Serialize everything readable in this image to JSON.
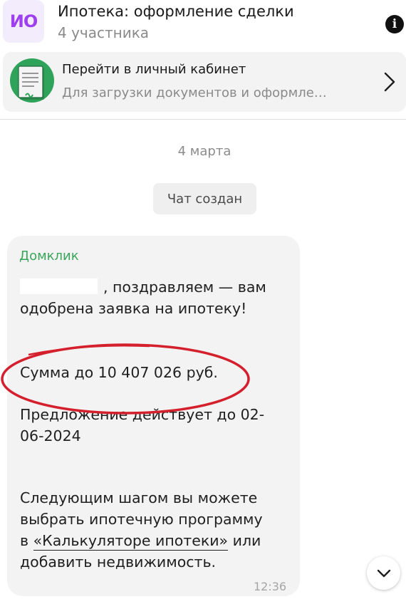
{
  "header": {
    "avatar_initials": "ИО",
    "title": "Ипотека: оформление сделки",
    "subtitle": "4 участника",
    "info_icon": "info-icon"
  },
  "banner": {
    "title": "Перейти в личный кабинет",
    "subtitle": "Для загрузки документов и оформле…",
    "icon": "document-icon",
    "chevron": "chevron-right-icon"
  },
  "chat": {
    "date": "4 марта",
    "system_message": "Чат создан"
  },
  "message": {
    "sender": "Домклик",
    "line1": ", поздравляем — вам",
    "line2": "одобрена заявка на ипотеку!",
    "sum": "Сумма до 10 407 026 руб.",
    "offer_line1": "Предложение действует до 02-",
    "offer_line2": "06-2024",
    "next_line1": "Следующим шагом вы можете",
    "next_line2": "выбрать ипотечную программу",
    "next_line3_prefix": "в ",
    "link_text": "«Калькуляторе ипотеки»",
    "next_line3_suffix": " или",
    "next_line4": "добавить недвижимость.",
    "time": "12:36"
  },
  "colors": {
    "avatar_bg": "#f3ecfd",
    "avatar_text": "#9e3ff0",
    "sender": "#3aa65c",
    "annotation": "#d4202c",
    "bubble_bg": "#f3f3f3"
  }
}
